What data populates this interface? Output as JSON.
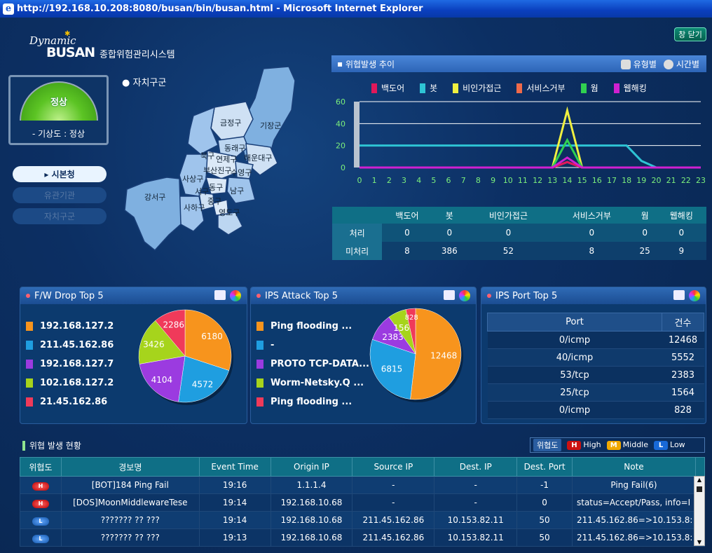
{
  "window": {
    "title": "http://192.168.10.208:8080/busan/bin/busan.html - Microsoft Internet Explorer"
  },
  "header": {
    "logo_top": "Dynamic",
    "logo_main": "BUSAN",
    "system_name": "종합위험관리시스템",
    "close_label": "창 닫기"
  },
  "gauge": {
    "status": "정상",
    "caption": "- 기상도 : 정상"
  },
  "side_menu": {
    "items": [
      {
        "label": "시본청"
      },
      {
        "label": "유관기관"
      },
      {
        "label": "자치구군"
      }
    ]
  },
  "map": {
    "title": "자치구군",
    "districts": [
      "기장군",
      "금정구",
      "북구",
      "동래구",
      "연제구",
      "해운대구",
      "부산진구",
      "수영구",
      "사상구",
      "남구",
      "강서구",
      "동구",
      "서구",
      "중구",
      "사하구",
      "영도구"
    ]
  },
  "trend": {
    "title": "위협발생 추이",
    "btn_type": "유형별",
    "btn_time": "시간별"
  },
  "summary": {
    "headers": [
      "",
      "백도어",
      "봇",
      "비인가접근",
      "서비스거부",
      "웜",
      "웹해킹"
    ],
    "rows": [
      {
        "label": "처리",
        "values": [
          "0",
          "0",
          "0",
          "0",
          "0",
          "0"
        ]
      },
      {
        "label": "미처리",
        "values": [
          "8",
          "386",
          "52",
          "8",
          "25",
          "9"
        ]
      }
    ]
  },
  "fw_drop": {
    "title": "F/W Drop Top 5",
    "items": [
      {
        "label": "192.168.127.2",
        "value": 6180,
        "color": "#f7941d"
      },
      {
        "label": "211.45.162.86",
        "value": 4572,
        "color": "#1f9ee0"
      },
      {
        "label": "192.168.127.7",
        "value": 4104,
        "color": "#9b3be0"
      },
      {
        "label": "102.168.127.2",
        "value": 3426,
        "color": "#a6d41c"
      },
      {
        "label": "21.45.162.86",
        "value": 2286,
        "color": "#f03a5a"
      }
    ]
  },
  "ips_attack": {
    "title": "IPS Attack Top 5",
    "items": [
      {
        "label": "Ping flooding ...",
        "value": 12468,
        "color": "#f7941d"
      },
      {
        "label": "-",
        "value": 6815,
        "color": "#1f9ee0"
      },
      {
        "label": "PROTO TCP-DATA...",
        "value": 2383,
        "color": "#9b3be0"
      },
      {
        "label": "Worm-Netsky.Q ...",
        "value": 1564,
        "color": "#a6d41c"
      },
      {
        "label": "Ping flooding ...",
        "value": 828,
        "color": "#f03a5a"
      }
    ]
  },
  "ips_port": {
    "title": "IPS Port Top 5",
    "headers": [
      "Port",
      "건수"
    ],
    "rows": [
      {
        "port": "0/icmp",
        "count": "12468"
      },
      {
        "port": "40/icmp",
        "count": "5552"
      },
      {
        "port": "53/tcp",
        "count": "2383"
      },
      {
        "port": "25/tcp",
        "count": "1564"
      },
      {
        "port": "0/icmp",
        "count": "828"
      }
    ]
  },
  "events": {
    "title": "위협 발생 현황",
    "legend": {
      "label": "위협도",
      "high": "High",
      "middle": "Middle",
      "low": "Low"
    },
    "headers": [
      "위협도",
      "경보명",
      "Event Time",
      "Origin IP",
      "Source IP",
      "Dest. IP",
      "Dest. Port",
      "Note"
    ],
    "rows": [
      {
        "level": "H",
        "name": "[BOT]184 Ping Fail",
        "time": "19:16",
        "origin": "1.1.1.4",
        "src": "-",
        "dst": "-",
        "port": "-1",
        "note": "Ping Fail(6)"
      },
      {
        "level": "H",
        "name": "[DOS]MoonMiddlewareTese",
        "time": "19:14",
        "origin": "192.168.10.68",
        "src": "-",
        "dst": "-",
        "port": "0",
        "note": "status=Accept/Pass, info=I"
      },
      {
        "level": "L",
        "name": "??????? ?? ???",
        "time": "19:14",
        "origin": "192.168.10.68",
        "src": "211.45.162.86",
        "dst": "10.153.82.11",
        "port": "50",
        "note": "211.45.162.86=>10.153.8:"
      },
      {
        "level": "L",
        "name": "??????? ?? ???",
        "time": "19:13",
        "origin": "192.168.10.68",
        "src": "211.45.162.86",
        "dst": "10.153.82.11",
        "port": "50",
        "note": "211.45.162.86=>10.153.8:"
      }
    ]
  },
  "chart_data": {
    "type": "line",
    "x": [
      0,
      1,
      2,
      3,
      4,
      5,
      6,
      7,
      8,
      9,
      10,
      11,
      12,
      13,
      14,
      15,
      16,
      17,
      18,
      19,
      20,
      21,
      22,
      23
    ],
    "ylim": [
      0,
      60
    ],
    "yticks": [
      0,
      20,
      40,
      60
    ],
    "series": [
      {
        "name": "백도어",
        "color": "#e0185a",
        "values": [
          0,
          0,
          0,
          0,
          0,
          0,
          0,
          0,
          0,
          0,
          0,
          0,
          0,
          0,
          5,
          0,
          0,
          0,
          0,
          0,
          0,
          0,
          0,
          0
        ]
      },
      {
        "name": "봇",
        "color": "#2ec4d4",
        "values": [
          20,
          20,
          20,
          20,
          20,
          20,
          20,
          20,
          20,
          20,
          20,
          20,
          20,
          20,
          20,
          20,
          20,
          20,
          20,
          6,
          0,
          0,
          0,
          0
        ]
      },
      {
        "name": "비인가접근",
        "color": "#f0f040",
        "values": [
          0,
          0,
          0,
          0,
          0,
          0,
          0,
          0,
          0,
          0,
          0,
          0,
          0,
          0,
          52,
          0,
          0,
          0,
          0,
          0,
          0,
          0,
          0,
          0
        ]
      },
      {
        "name": "서비스거부",
        "color": "#f06a4a",
        "values": [
          0,
          0,
          0,
          0,
          0,
          0,
          0,
          0,
          0,
          0,
          0,
          0,
          0,
          0,
          5,
          0,
          0,
          0,
          0,
          0,
          0,
          0,
          0,
          0
        ]
      },
      {
        "name": "웜",
        "color": "#30d050",
        "values": [
          0,
          0,
          0,
          0,
          0,
          0,
          0,
          0,
          0,
          0,
          0,
          0,
          0,
          0,
          25,
          0,
          0,
          0,
          0,
          0,
          0,
          0,
          0,
          0
        ]
      },
      {
        "name": "웹해킹",
        "color": "#d020d0",
        "values": [
          0,
          0,
          0,
          0,
          0,
          0,
          0,
          0,
          0,
          0,
          0,
          0,
          0,
          0,
          9,
          0,
          0,
          0,
          0,
          0,
          0,
          0,
          0,
          0
        ]
      }
    ]
  }
}
